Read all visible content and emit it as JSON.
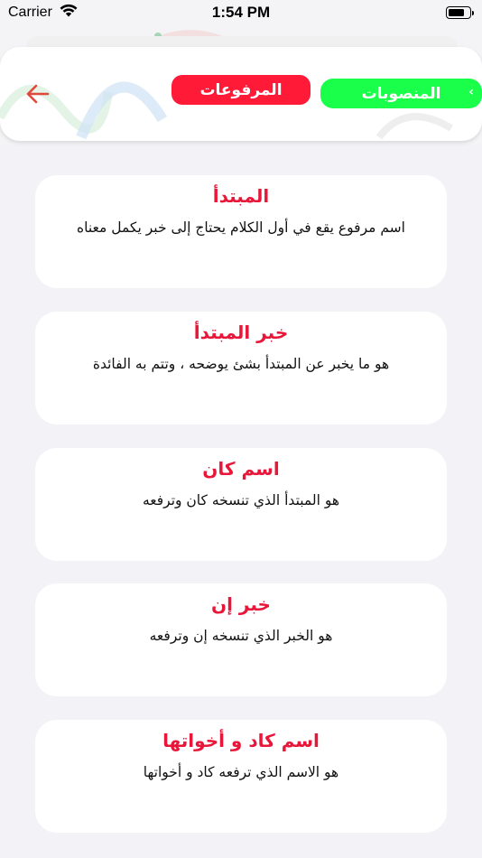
{
  "status_bar": {
    "carrier": "Carrier",
    "time": "1:54 PM"
  },
  "header": {
    "tabs": [
      {
        "label": "المرفوعات",
        "color": "#ff1a38"
      },
      {
        "label": "المنصوبات",
        "color": "#1aff4a"
      }
    ],
    "back_icon": "arrow-left-icon",
    "back_color": "#e0483a"
  },
  "cards": [
    {
      "title": "المبتدأ",
      "description": "اسم مرفوع يقع في أول الكلام يحتاج إلى خبر يكمل معناه"
    },
    {
      "title": "خبر المبتدأ",
      "description": "هو ما يخبر عن المبتدأ بشئ يوضحه ، وتتم به الفائدة"
    },
    {
      "title": "اسم كان",
      "description": "هو المبتدأ الذي تنسخه كان وترفعه"
    },
    {
      "title": "خبر إن",
      "description": "هو الخبر الذي تنسخه إن وترفعه"
    },
    {
      "title": "اسم كاد و أخواتها",
      "description": "هو الاسم الذي ترفعه كاد و أخواتها"
    }
  ],
  "colors": {
    "accent_red": "#e8173a",
    "background": "#f2f2f7"
  }
}
